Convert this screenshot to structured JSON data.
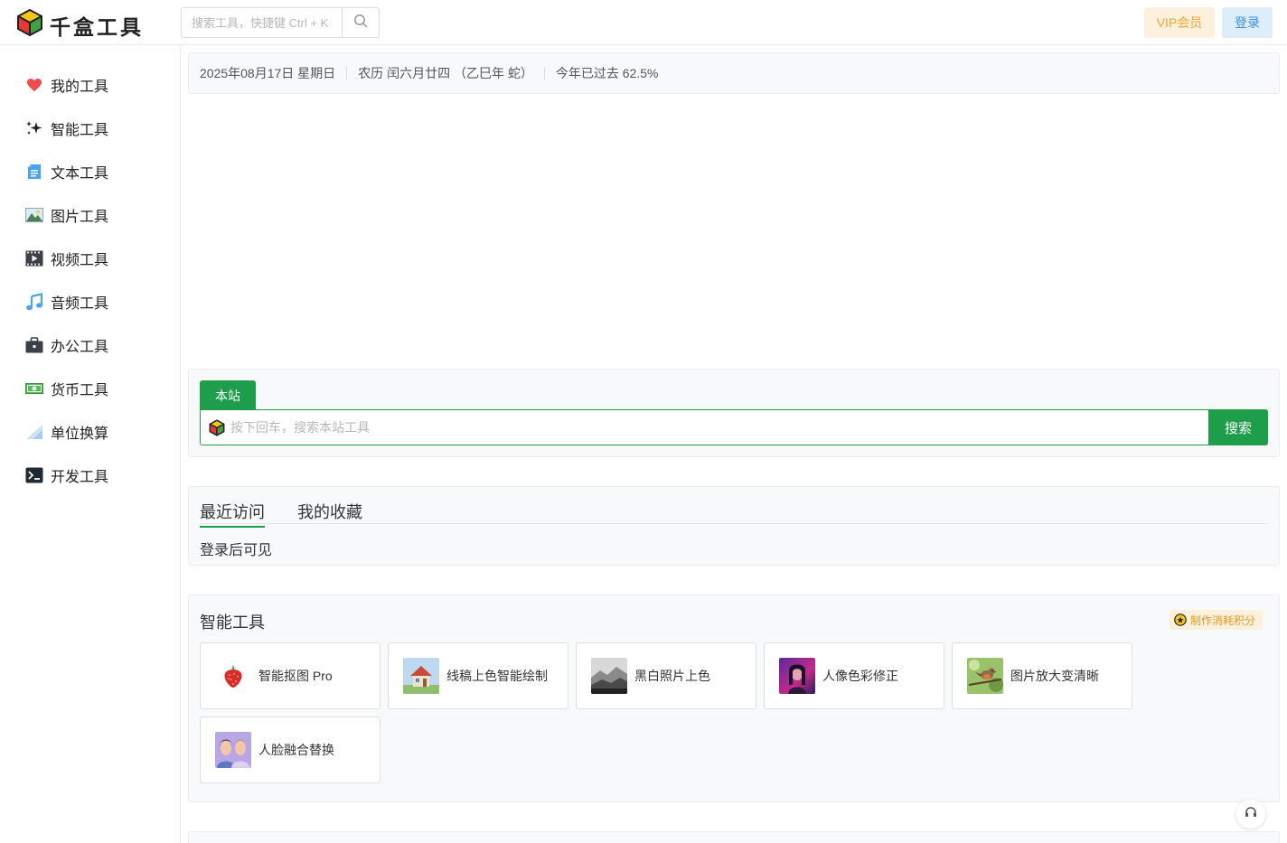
{
  "header": {
    "logo_text": "千盒工具",
    "search_placeholder": "搜索工具，快捷键 Ctrl + K",
    "vip_label": "VIP会员",
    "login_label": "登录"
  },
  "sidebar": {
    "items": [
      {
        "label": "我的工具",
        "icon": "heart-icon"
      },
      {
        "label": "智能工具",
        "icon": "sparkle-icon"
      },
      {
        "label": "文本工具",
        "icon": "document-icon"
      },
      {
        "label": "图片工具",
        "icon": "image-icon"
      },
      {
        "label": "视频工具",
        "icon": "film-icon"
      },
      {
        "label": "音频工具",
        "icon": "music-icon"
      },
      {
        "label": "办公工具",
        "icon": "briefcase-icon"
      },
      {
        "label": "货币工具",
        "icon": "banknote-icon"
      },
      {
        "label": "单位换算",
        "icon": "ruler-icon"
      },
      {
        "label": "开发工具",
        "icon": "terminal-icon"
      }
    ]
  },
  "datebar": {
    "date": "2025年08月17日 星期日",
    "lunar": "农历 闰六月廿四 （乙巳年 蛇）",
    "progress_text": "今年已过去 62.5%",
    "year_progress": 62.5
  },
  "site_search": {
    "tab_label": "本站",
    "placeholder": "按下回车，搜索本站工具",
    "button_label": "搜索"
  },
  "recent": {
    "tabs": [
      {
        "label": "最近访问",
        "active": true
      },
      {
        "label": "我的收藏",
        "active": false
      }
    ],
    "note": "登录后可见"
  },
  "smart_tools": {
    "title": "智能工具",
    "badge": "制作消耗积分",
    "tools": [
      {
        "name": "智能抠图 Pro",
        "thumb": "strawberry"
      },
      {
        "name": "线稿上色智能绘制",
        "thumb": "house"
      },
      {
        "name": "黑白照片上色",
        "thumb": "mountain"
      },
      {
        "name": "人像色彩修正",
        "thumb": "portrait"
      },
      {
        "name": "图片放大变清晰",
        "thumb": "bird"
      },
      {
        "name": "人脸融合替换",
        "thumb": "faces"
      }
    ]
  },
  "colors": {
    "accent_green": "#1e9e4a",
    "vip_bg": "#fdf0dc",
    "vip_text": "#f0a637",
    "login_bg": "#ddeefa",
    "login_text": "#3a8ee6"
  }
}
